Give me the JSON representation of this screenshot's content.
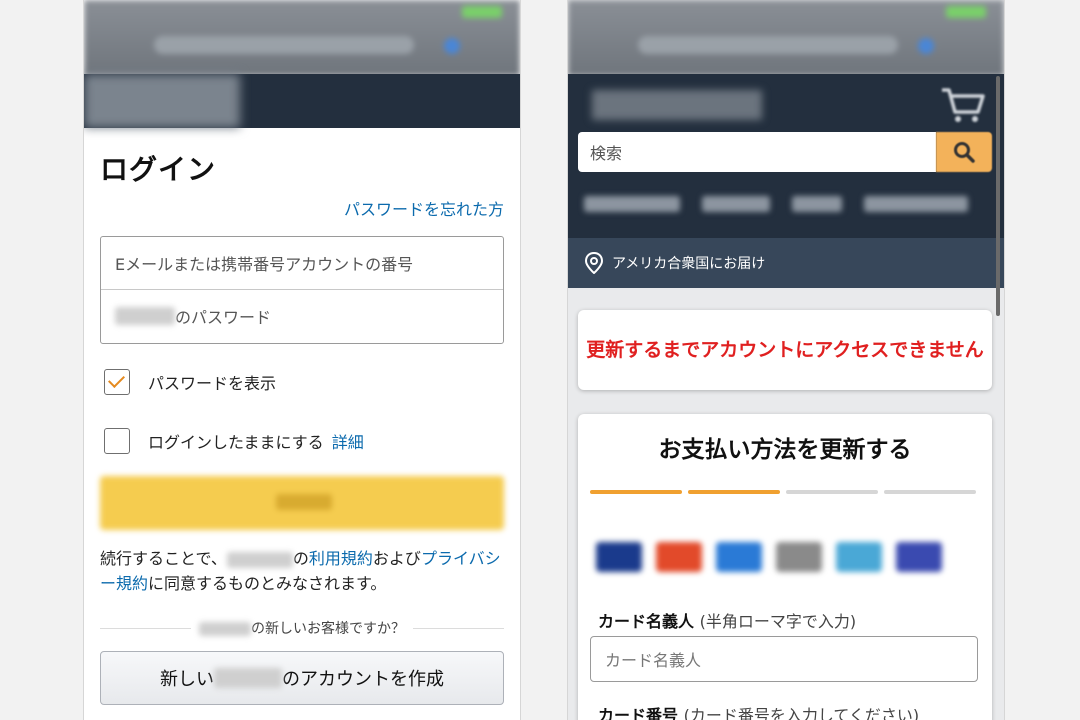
{
  "left": {
    "title": "ログイン",
    "forgot_password": "パスワードを忘れた方",
    "email_placeholder": "Eメールまたは携帯番号アカウントの番号",
    "password_placeholder_suffix": "のパスワード",
    "show_password_label": "パスワードを表示",
    "show_password_checked": true,
    "stay_signed_in_label": "ログインしたままにする",
    "details_link": "詳細",
    "legal_prefix": "続行することで、",
    "legal_no": "の",
    "terms_link": "利用規約",
    "legal_and": "および",
    "privacy_link": "プライバシー規約",
    "legal_suffix": "に同意するものとみなされます。",
    "new_customer_suffix": "の新しいお客様ですか？",
    "create_account_prefix": "新しい",
    "create_account_suffix": "のアカウントを作成"
  },
  "right": {
    "search_placeholder": "検索",
    "deliver_to": "アメリカ合衆国にお届け",
    "alert": "更新するまでアカウントにアクセスできません",
    "payment_title": "お支払い方法を更新する",
    "steps_completed": 2,
    "steps_total": 4,
    "cardholder_label": "カード名義人",
    "cardholder_hint": "(半角ローマ字で入力)",
    "cardholder_placeholder": "カード名義人",
    "card_number_label": "カード番号",
    "card_number_hint": "(カード番号を入力してください)"
  },
  "colors": {
    "amazon_navy": "#232f3e",
    "subnav": "#37475a",
    "link_blue": "#0b6aad",
    "alert_red": "#e02020",
    "accent_orange": "#f0a030",
    "signin_yellow": "#f5cc4f"
  },
  "icons": [
    "checkmark-icon",
    "search-icon",
    "cart-icon",
    "location-pin-icon"
  ]
}
